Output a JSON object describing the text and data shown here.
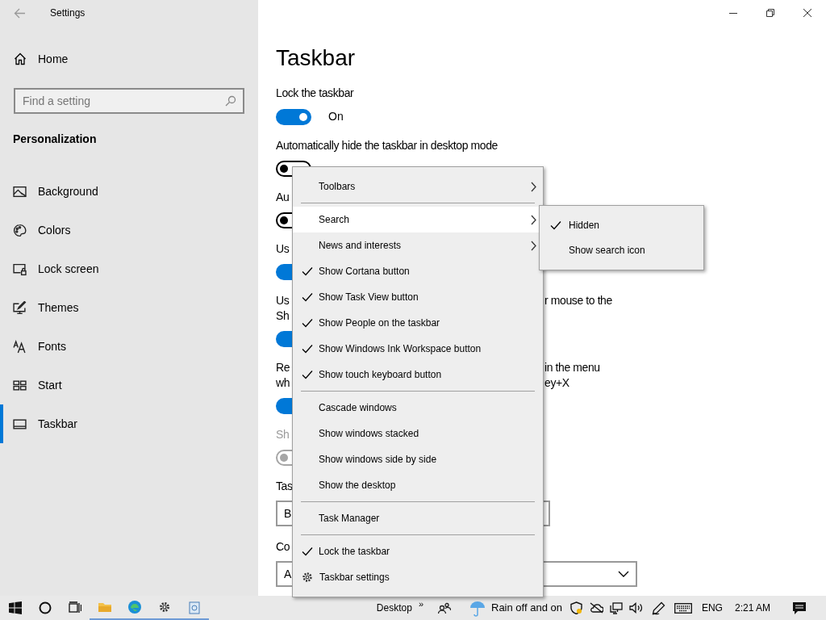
{
  "window": {
    "title": "Settings"
  },
  "sidebar": {
    "home": "Home",
    "search": {
      "placeholder": "Find a setting"
    },
    "section": "Personalization",
    "items": [
      {
        "label": "Background",
        "selected": false
      },
      {
        "label": "Colors",
        "selected": false
      },
      {
        "label": "Lock screen",
        "selected": false
      },
      {
        "label": "Themes",
        "selected": false
      },
      {
        "label": "Fonts",
        "selected": false
      },
      {
        "label": "Start",
        "selected": false
      },
      {
        "label": "Taskbar",
        "selected": true
      }
    ]
  },
  "page": {
    "title": "Taskbar",
    "settings": [
      {
        "lines": [
          {
            "left": "Lock the taskbar"
          }
        ],
        "disabled": false,
        "control": {
          "kind": "toggle",
          "on": true,
          "state_text": "On"
        }
      },
      {
        "lines": [
          {
            "left": "Automatically hide the taskbar in desktop mode"
          }
        ],
        "disabled": false,
        "control": {
          "kind": "toggle",
          "on": false
        }
      },
      {
        "lines": [
          {
            "left": "Au"
          }
        ],
        "disabled": false,
        "control": {
          "kind": "toggle",
          "on": false
        }
      },
      {
        "lines": [
          {
            "left": "Us"
          }
        ],
        "disabled": false,
        "control": {
          "kind": "toggle",
          "on": true
        }
      },
      {
        "lines": [
          {
            "left": "Us",
            "right": "r mouse to the"
          },
          {
            "left": "Sh"
          }
        ],
        "disabled": false,
        "control": {
          "kind": "toggle",
          "on": true
        }
      },
      {
        "lines": [
          {
            "left": "Re",
            "right": "in the menu"
          },
          {
            "left": "wh",
            "right": "ey+X"
          }
        ],
        "disabled": false,
        "control": {
          "kind": "toggle",
          "on": true
        }
      },
      {
        "lines": [
          {
            "left": "Sh"
          }
        ],
        "disabled": true,
        "control": {
          "kind": "toggle",
          "on": false
        }
      },
      {
        "lines": [
          {
            "left": "Tas"
          }
        ],
        "disabled": false,
        "control": {
          "kind": "dropdown",
          "value": "B",
          "wide": false
        }
      },
      {
        "lines": [
          {
            "left": "Co"
          }
        ],
        "disabled": false,
        "control": {
          "kind": "dropdown",
          "value": "A",
          "wide": true
        }
      }
    ]
  },
  "context_menu": {
    "sections": [
      [
        {
          "label": "Toolbars",
          "kind": "submenu",
          "checked": false,
          "selected": false
        }
      ],
      [
        {
          "label": "Search",
          "kind": "submenu",
          "checked": false,
          "selected": true
        },
        {
          "label": "News and interests",
          "kind": "submenu",
          "checked": false,
          "selected": false
        },
        {
          "label": "Show Cortana button",
          "kind": "command",
          "checked": true,
          "selected": false
        },
        {
          "label": "Show Task View button",
          "kind": "command",
          "checked": true,
          "selected": false
        },
        {
          "label": "Show People on the taskbar",
          "kind": "command",
          "checked": true,
          "selected": false
        },
        {
          "label": "Show Windows Ink Workspace button",
          "kind": "command",
          "checked": true,
          "selected": false
        },
        {
          "label": "Show touch keyboard button",
          "kind": "command",
          "checked": true,
          "selected": false
        }
      ],
      [
        {
          "label": "Cascade windows",
          "kind": "command",
          "checked": false,
          "selected": false
        },
        {
          "label": "Show windows stacked",
          "kind": "command",
          "checked": false,
          "selected": false
        },
        {
          "label": "Show windows side by side",
          "kind": "command",
          "checked": false,
          "selected": false
        },
        {
          "label": "Show the desktop",
          "kind": "command",
          "checked": false,
          "selected": false
        }
      ],
      [
        {
          "label": "Task Manager",
          "kind": "command",
          "checked": false,
          "selected": false
        }
      ],
      [
        {
          "label": "Lock the taskbar",
          "kind": "command",
          "checked": true,
          "selected": false
        },
        {
          "label": "Taskbar settings",
          "kind": "settings",
          "selected": false
        }
      ]
    ],
    "submenu": [
      {
        "label": "Hidden",
        "checked": true
      },
      {
        "label": "Show search icon",
        "checked": false
      }
    ]
  },
  "taskbar": {
    "desktop": "Desktop",
    "chevron": "»",
    "weather": "Rain off and on",
    "language": "ENG",
    "time": "2:21 AM"
  }
}
